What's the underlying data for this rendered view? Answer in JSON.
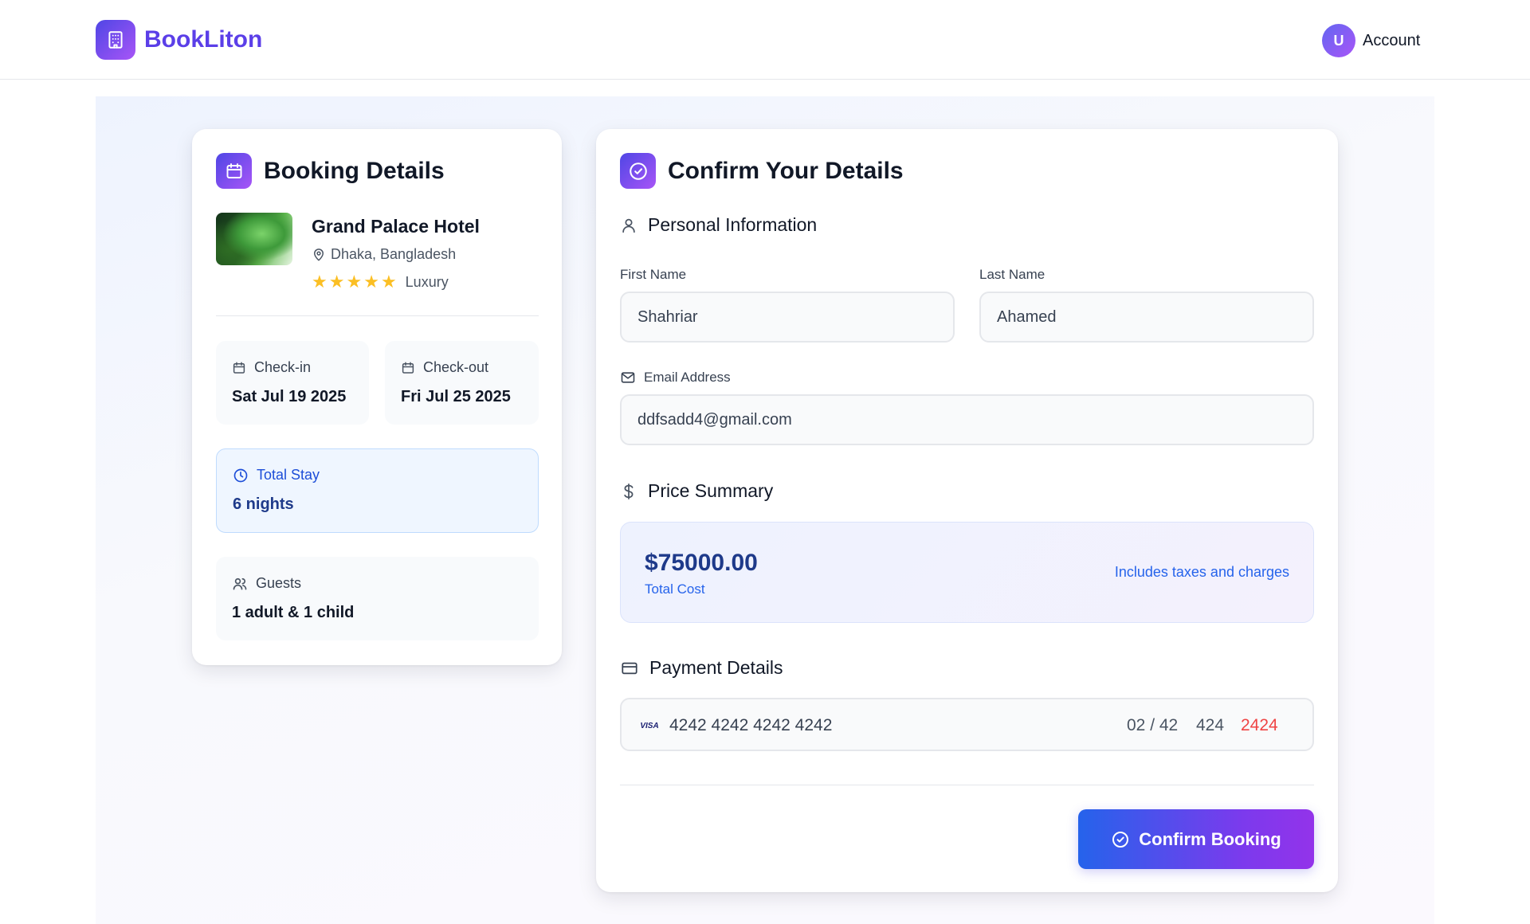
{
  "brand": {
    "name": "BookLiton",
    "icon": "building-icon"
  },
  "account": {
    "avatar_initial": "U",
    "label": "Account"
  },
  "booking": {
    "title": "Booking Details",
    "hotel": {
      "name": "Grand Palace Hotel",
      "location": "Dhaka, Bangladesh",
      "stars": 5,
      "category": "Luxury"
    },
    "checkin": {
      "label": "Check-in",
      "value": "Sat Jul 19 2025"
    },
    "checkout": {
      "label": "Check-out",
      "value": "Fri Jul 25 2025"
    },
    "stay": {
      "label": "Total Stay",
      "value": "6 nights"
    },
    "guests": {
      "label": "Guests",
      "value": "1 adult & 1 child"
    }
  },
  "confirm": {
    "title": "Confirm Your Details",
    "personal": {
      "heading": "Personal Information",
      "first_name": {
        "label": "First Name",
        "value": "Shahriar"
      },
      "last_name": {
        "label": "Last Name",
        "value": "Ahamed"
      },
      "email": {
        "label": "Email Address",
        "value": "ddfsadd4@gmail.com"
      }
    },
    "price": {
      "heading": "Price Summary",
      "amount": "$75000.00",
      "caption": "Total Cost",
      "note": "Includes taxes and charges"
    },
    "payment": {
      "heading": "Payment Details",
      "brand": "VISA",
      "number": "4242 4242 4242 4242",
      "expiry": "02 / 42",
      "cvc": "424",
      "zip": "2424"
    },
    "button_label": "Confirm Booking"
  },
  "colors": {
    "brand_gradient_start": "#4f46e5",
    "brand_gradient_end": "#a855f7",
    "accent_blue": "#2563eb",
    "error_red": "#ef4444"
  }
}
